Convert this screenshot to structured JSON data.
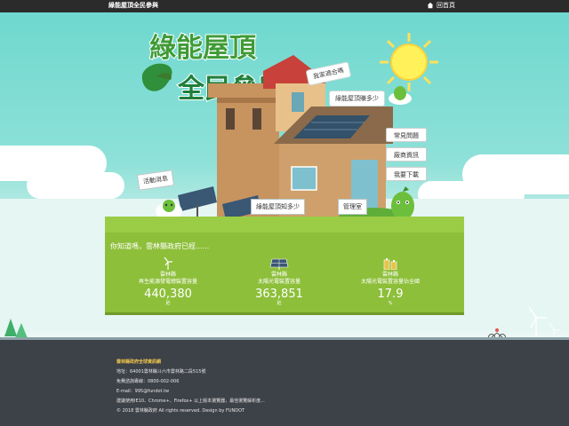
{
  "topbar": {
    "title": "綠能屋頂全民參與",
    "home_label": "回首頁"
  },
  "logo": {
    "line1": "綠能屋頂",
    "line2": "全民參與"
  },
  "tags": {
    "my_home": "我家適合嗎",
    "earn": "綠能屋頂賺多少",
    "news": "活動消息",
    "know": "綠能屋頂知多少",
    "admin": "管理室"
  },
  "side_menu": [
    "常見問題",
    "廠商資訊",
    "我要下載"
  ],
  "panel": {
    "intro": "你知道嗎，雲林縣政府已經......",
    "stats": [
      {
        "name": "雲林縣",
        "label": "再生能源發電總裝置容量",
        "value": "440,380",
        "unit": "瓩",
        "icon": "wind-turbine-icon"
      },
      {
        "name": "雲林縣",
        "label": "太陽光電裝置容量",
        "value": "363,851",
        "unit": "瓩",
        "icon": "solar-panel-icon"
      },
      {
        "name": "雲林縣",
        "label": "太陽光電裝置容量佔全國",
        "value": "17.9",
        "unit": "%",
        "icon": "battery-icon"
      }
    ]
  },
  "footer": {
    "title": "雲林縣政府全球資訊網",
    "address": "地址：64001雲林縣斗六市雲林路二段515號",
    "phone": "免費諮詢專線：0800-002-006",
    "email": "E-mail：995@fundot.tw",
    "browser": "建議使用IE10、Chrome+、Firefox+ 以上版本瀏覽器，最佳瀏覽解析度...",
    "copyright": "© 2018 雲林縣政府 All rights reserved. Design by FUNDOT"
  },
  "colors": {
    "sky": "#6fd8cf",
    "panel": "#8dbf3a",
    "footer": "#3d4148",
    "accent": "#f2c94c"
  }
}
